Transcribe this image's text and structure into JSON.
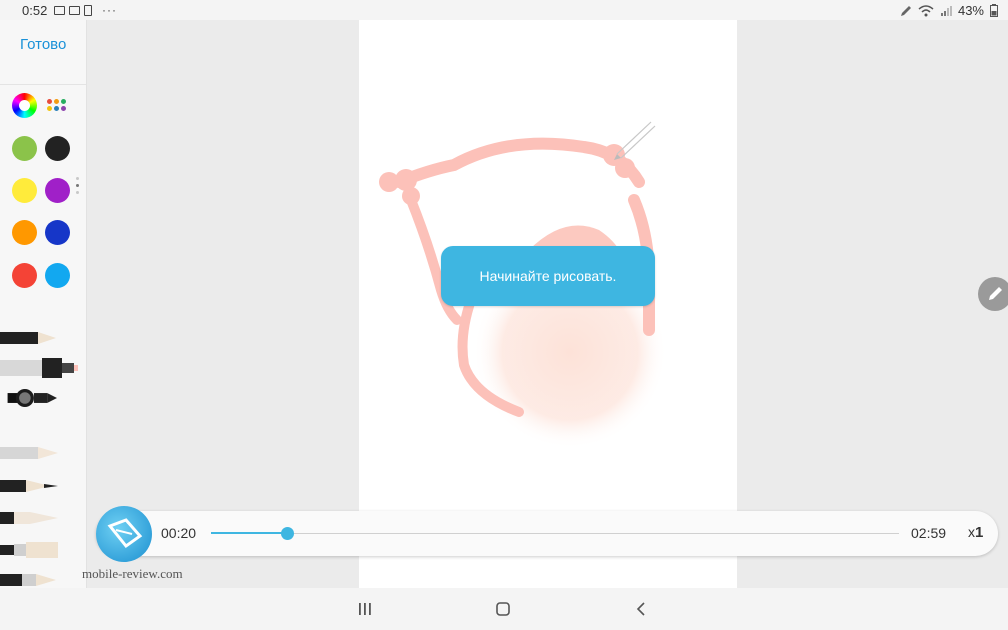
{
  "status_bar": {
    "time": "0:52",
    "ellipsis": "···",
    "battery": "43%"
  },
  "sidebar": {
    "done_label": "Готово",
    "color_wheel_icon": "color-wheel-icon",
    "palette_icon": "palette-dots-icon",
    "colors": [
      {
        "name": "green",
        "hex": "#8bc34a"
      },
      {
        "name": "black",
        "hex": "#222222"
      },
      {
        "name": "yellow",
        "hex": "#ffeb3b"
      },
      {
        "name": "purple",
        "hex": "#a020c8"
      },
      {
        "name": "orange",
        "hex": "#ff9800"
      },
      {
        "name": "blue",
        "hex": "#1636c8"
      },
      {
        "name": "red",
        "hex": "#f44336"
      },
      {
        "name": "light-blue",
        "hex": "#12a8f0"
      }
    ],
    "tools": [
      "pencil",
      "marker",
      "brush",
      "crayon",
      "fountain-pen",
      "chalk",
      "flat-brush",
      "eraser-pen"
    ]
  },
  "canvas": {
    "hint": "Начинайте рисовать.",
    "edit_icon": "pencil-icon"
  },
  "player": {
    "current_time": "00:20",
    "total_time": "02:59",
    "speed_prefix": "x",
    "speed_value": "1",
    "progress": 0.11
  },
  "watermark": {
    "text": "mobile-review.com"
  },
  "colors": {
    "accent": "#3eb6e1",
    "done_text": "#1a91d8",
    "stroke": "#fcc1b9"
  },
  "nav": {
    "recents_icon": "recents-icon",
    "home_icon": "home-icon",
    "back_icon": "back-icon"
  }
}
